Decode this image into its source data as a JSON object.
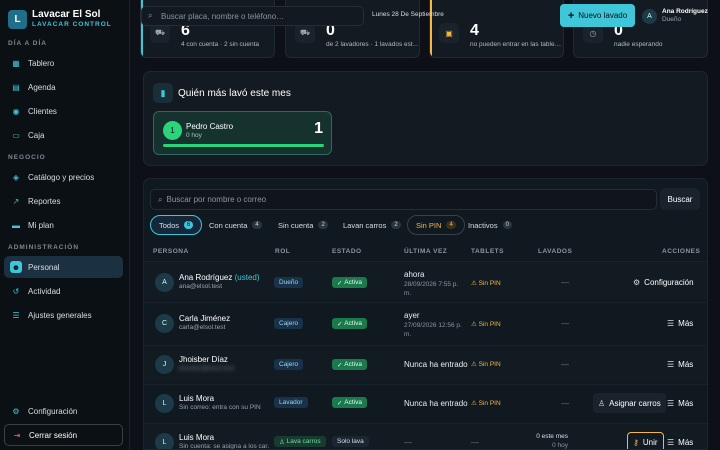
{
  "app": {
    "name": "Lavacar El Sol",
    "subtitle": "LAVACAR CONTROL",
    "logo_letter": "L"
  },
  "sidebar": {
    "sections": [
      {
        "title": "DÍA A DÍA",
        "items": [
          {
            "label": "Tablero",
            "icon": "grid-icon"
          },
          {
            "label": "Agenda",
            "icon": "calendar-icon"
          },
          {
            "label": "Clientes",
            "icon": "users-icon"
          },
          {
            "label": "Caja",
            "icon": "cash-icon"
          }
        ]
      },
      {
        "title": "NEGOCIO",
        "items": [
          {
            "label": "Catálogo y precios",
            "icon": "tag-icon"
          },
          {
            "label": "Reportes",
            "icon": "chart-icon"
          },
          {
            "label": "Mi plan",
            "icon": "card-icon"
          }
        ]
      },
      {
        "title": "ADMINISTRACIÓN",
        "items": [
          {
            "label": "Personal",
            "icon": "people-icon",
            "active": true
          },
          {
            "label": "Actividad",
            "icon": "history-icon"
          },
          {
            "label": "Ajustes generales",
            "icon": "sliders-icon"
          }
        ]
      }
    ],
    "footer": {
      "settings": "Configuración",
      "logout": "Cerrar sesión"
    }
  },
  "topbar": {
    "search_placeholder": "Buscar placa, nombre o teléfono…",
    "date": "Lunes 28 De Septiembre",
    "new_wash": "Nuevo lavado",
    "user": {
      "initial": "A",
      "name": "Ana Rodríguez",
      "role": "Dueño"
    }
  },
  "stats": [
    {
      "value": "6",
      "text": "4 con cuenta · 2 sin cuenta",
      "accent": "#3fc6d8"
    },
    {
      "value": "0",
      "text": "de 2 lavadores · 1 lavados est…",
      "accent": "#2bd47a"
    },
    {
      "value": "4",
      "text": "no pueden entrar en las table…",
      "accent": "#f5b942"
    },
    {
      "value": "0",
      "text": "nadie esperando",
      "accent": "#2a3540"
    }
  ],
  "top_washer": {
    "title": "Quién más lavó este mes",
    "rank": "1",
    "name": "Pedro Castro",
    "sub": "0 hoy",
    "count": "1",
    "share": 1.0
  },
  "staff": {
    "search_placeholder": "Buscar por nombre o correo",
    "search_button": "Buscar",
    "filters": [
      {
        "label": "Todos",
        "count": "6"
      },
      {
        "label": "Con cuenta",
        "count": "4"
      },
      {
        "label": "Sin cuenta",
        "count": "2"
      },
      {
        "label": "Lavan carros",
        "count": "2"
      },
      {
        "label": "Sin PIN",
        "count": "4"
      },
      {
        "label": "Inactivos",
        "count": "0"
      }
    ],
    "columns": [
      "PERSONA",
      "ROL",
      "ESTADO",
      "ÚLTIMA VEZ",
      "TABLETS",
      "LAVADOS",
      "ACCIONES"
    ],
    "rows": [
      {
        "initial": "A",
        "name": "Ana Rodríguez",
        "tag": "(usted)",
        "email": "ana@elsol.test",
        "role": "Dueño",
        "status": "Activa",
        "last": "ahora",
        "last_date": "28/09/2026 7:55 p. m.",
        "tablets": "Sin PIN",
        "washes": "—",
        "action": "Configuración"
      },
      {
        "initial": "C",
        "name": "Carla Jiménez",
        "tag": "",
        "email": "carla@elsol.test",
        "role": "Cajero",
        "status": "Activa",
        "last": "ayer",
        "last_date": "27/09/2026 12:56 p. m.",
        "tablets": "Sin PIN",
        "washes": "—",
        "action": "Más"
      },
      {
        "initial": "J",
        "name": "Jhoisber Díaz",
        "tag": "",
        "email": "jhoisber@elsol.test",
        "role": "Cajero",
        "status": "Activa",
        "last": "Nunca ha entrado",
        "last_date": "",
        "tablets": "Sin PIN",
        "washes": "—",
        "action": "Más"
      },
      {
        "initial": "L",
        "name": "Luis Mora",
        "tag": "",
        "email": "Sin correo: entra con su PIN",
        "role": "Lavador",
        "status": "Activa",
        "last": "Nunca ha entrado",
        "last_date": "",
        "tablets": "Sin PIN",
        "washes": "—",
        "action": "Más",
        "extra_action": "Asignar carros"
      },
      {
        "initial": "L",
        "name": "Luis Mora",
        "tag": "",
        "email": "Sin cuenta: se asigna a los car…",
        "role": "Lava carros",
        "status": "Solo lava",
        "last": "—",
        "last_date": "",
        "tablets": "—",
        "washes": "0 este mes",
        "washes_sub": "0 hoy",
        "action": "Más",
        "extra_action": "Unir"
      }
    ]
  }
}
